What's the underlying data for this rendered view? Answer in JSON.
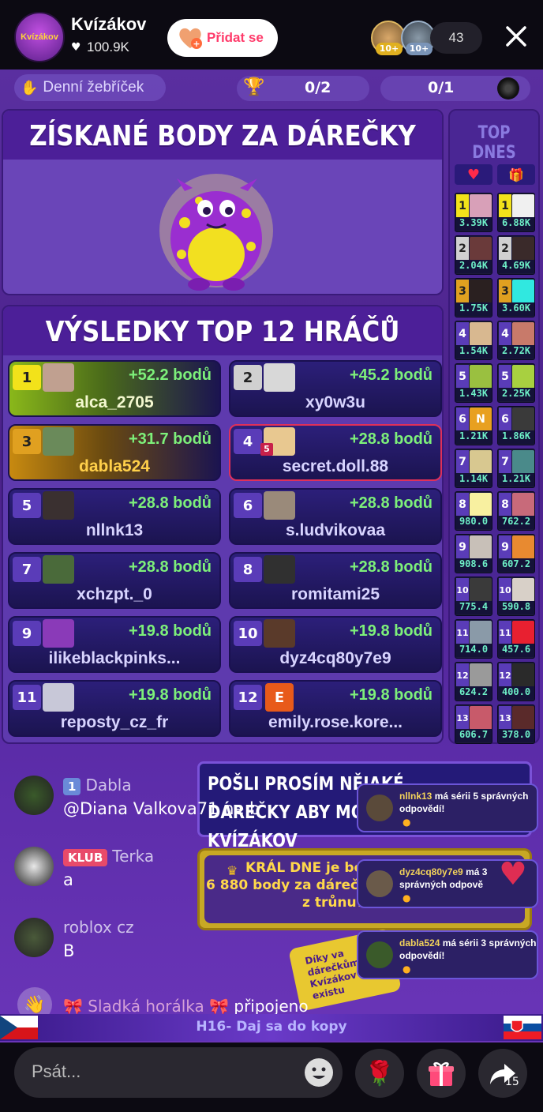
{
  "header": {
    "channel_name": "Kvízákov",
    "logo_text": "Kvízákov",
    "likes": "100.9K",
    "follow_label": "Přidat se",
    "viewer_badge_1": "10+",
    "viewer_badge_2": "10+",
    "viewer_count": "43"
  },
  "rankbar": {
    "daily_ranking_label": "Denní žebříček",
    "counter_1": "0/2",
    "counter_2": "0/1"
  },
  "gift_panel": {
    "title": "ZÍSKANÉ BODY ZA DÁREČKY"
  },
  "results": {
    "title": "VÝSLEDKY TOP 12 HRÁČŮ",
    "players": [
      {
        "rank": "1",
        "name": "alca_2705",
        "points": "+52.2 bodů"
      },
      {
        "rank": "2",
        "name": "xy0w3u",
        "points": "+45.2 bodů"
      },
      {
        "rank": "3",
        "name": "dabla524",
        "points": "+31.7 bodů"
      },
      {
        "rank": "4",
        "name": "secret.doll.88",
        "points": "+28.8 bodů",
        "badge": "5"
      },
      {
        "rank": "5",
        "name": "nllnk13",
        "points": "+28.8 bodů"
      },
      {
        "rank": "6",
        "name": "s.ludvikovaa",
        "points": "+28.8 bodů"
      },
      {
        "rank": "7",
        "name": "xchzpt._0",
        "points": "+28.8 bodů"
      },
      {
        "rank": "8",
        "name": "romitami25",
        "points": "+28.8 bodů"
      },
      {
        "rank": "9",
        "name": "ilikeblackpinks...",
        "points": "+19.8 bodů"
      },
      {
        "rank": "10",
        "name": "dyz4cq80y7e9",
        "points": "+19.8 bodů"
      },
      {
        "rank": "11",
        "name": "reposty_cz_fr",
        "points": "+19.8 bodů"
      },
      {
        "rank": "12",
        "name": "emily.rose.kore...",
        "points": "+19.8 bodů",
        "avatar_letter": "E"
      }
    ]
  },
  "top_today": {
    "title": "TOP DNES",
    "likes_column": [
      {
        "rank": "1",
        "value": "3.39K"
      },
      {
        "rank": "2",
        "value": "2.04K"
      },
      {
        "rank": "3",
        "value": "1.75K"
      },
      {
        "rank": "4",
        "value": "1.54K"
      },
      {
        "rank": "5",
        "value": "1.43K"
      },
      {
        "rank": "6",
        "value": "1.21K",
        "avatar_letter": "N"
      },
      {
        "rank": "7",
        "value": "1.14K"
      },
      {
        "rank": "8",
        "value": "980.0"
      },
      {
        "rank": "9",
        "value": "908.6"
      },
      {
        "rank": "10",
        "value": "775.4"
      },
      {
        "rank": "11",
        "value": "714.0"
      },
      {
        "rank": "12",
        "value": "624.2"
      },
      {
        "rank": "13",
        "value": "606.7"
      }
    ],
    "gifts_column": [
      {
        "rank": "1",
        "value": "6.88K"
      },
      {
        "rank": "2",
        "value": "4.69K"
      },
      {
        "rank": "3",
        "value": "3.60K"
      },
      {
        "rank": "4",
        "value": "2.72K"
      },
      {
        "rank": "5",
        "value": "2.25K"
      },
      {
        "rank": "6",
        "value": "1.86K"
      },
      {
        "rank": "7",
        "value": "1.21K"
      },
      {
        "rank": "8",
        "value": "762.2"
      },
      {
        "rank": "9",
        "value": "607.2"
      },
      {
        "rank": "10",
        "value": "590.8"
      },
      {
        "rank": "11",
        "value": "457.6"
      },
      {
        "rank": "12",
        "value": "400.0"
      },
      {
        "rank": "13",
        "value": "378.0"
      }
    ]
  },
  "overlay": {
    "banner_text": "POŠLI PROSÍM NĚJAKÉ DÁREČKY ABY MOHL KVÍZÁKOV",
    "king_text_1": "KRÁL DNE je bo",
    "king_text_2": "6 880 body za dárečk",
    "king_text_3": "z trůnu?",
    "thanks_text": "Díky va dárečkům Kvízákov existu"
  },
  "chat": [
    {
      "badge": "1",
      "user": "Dabla",
      "message": "@Diana Valkova71 ne b"
    },
    {
      "badge": "KLUB",
      "user": "Terka",
      "message": "a"
    },
    {
      "badge": "",
      "user": "roblox cz",
      "message": "B"
    }
  ],
  "join_notice": {
    "user": "Sladká horálka",
    "text": "připojeno"
  },
  "ticker": "H16- Daj sa do kopy",
  "notifications": [
    {
      "user": "nllnk13",
      "text": "má sérii 5 správných odpovědí!"
    },
    {
      "user": "dyz4cq80y7e9",
      "text": "má 3 správných odpově"
    },
    {
      "user": "dabla524",
      "text": "má sérii 3 správných odpovědí!"
    }
  ],
  "bottom": {
    "input_placeholder": "Psát...",
    "share_count": "15"
  },
  "colors": {
    "points_green": "#7df07a",
    "rank1_yellow": "#f2e21a",
    "rank2_grey": "#d0d0d0",
    "rank3_orange": "#e0a020",
    "panel_purple": "#5b34a8",
    "accent_pink": "#ff2a5c"
  }
}
